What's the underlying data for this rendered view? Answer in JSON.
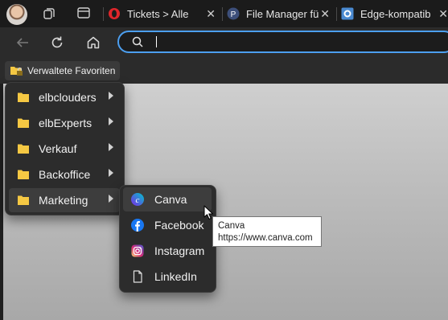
{
  "tabs": [
    {
      "title": "Tickets > Alle",
      "favicon": "opera-red-icon"
    },
    {
      "title": "File Manager fü",
      "favicon": "p-badge-icon"
    },
    {
      "title": "Edge-kompatib",
      "favicon": "gear-blue-icon"
    }
  ],
  "close_glyph": "✕",
  "favorites_bar": {
    "folder_label": "Verwaltete Favoriten"
  },
  "favorites_menu": [
    {
      "label": "elbclouders",
      "has_submenu": true
    },
    {
      "label": "elbExperts",
      "has_submenu": true
    },
    {
      "label": "Verkauf",
      "has_submenu": true
    },
    {
      "label": "Backoffice",
      "has_submenu": true
    },
    {
      "label": "Marketing",
      "has_submenu": true,
      "highlighted": true
    }
  ],
  "marketing_submenu": [
    {
      "label": "Canva",
      "icon": "canva-icon",
      "highlighted": true
    },
    {
      "label": "Facebook",
      "icon": "facebook-icon"
    },
    {
      "label": "Instagram",
      "icon": "instagram-icon"
    },
    {
      "label": "LinkedIn",
      "icon": "page-icon"
    }
  ],
  "tooltip": {
    "title": "Canva",
    "url": "https://www.canva.com"
  },
  "colors": {
    "accent": "#4c9ff0",
    "folder": "#f5c843",
    "menu_bg": "#2c2c2c"
  }
}
